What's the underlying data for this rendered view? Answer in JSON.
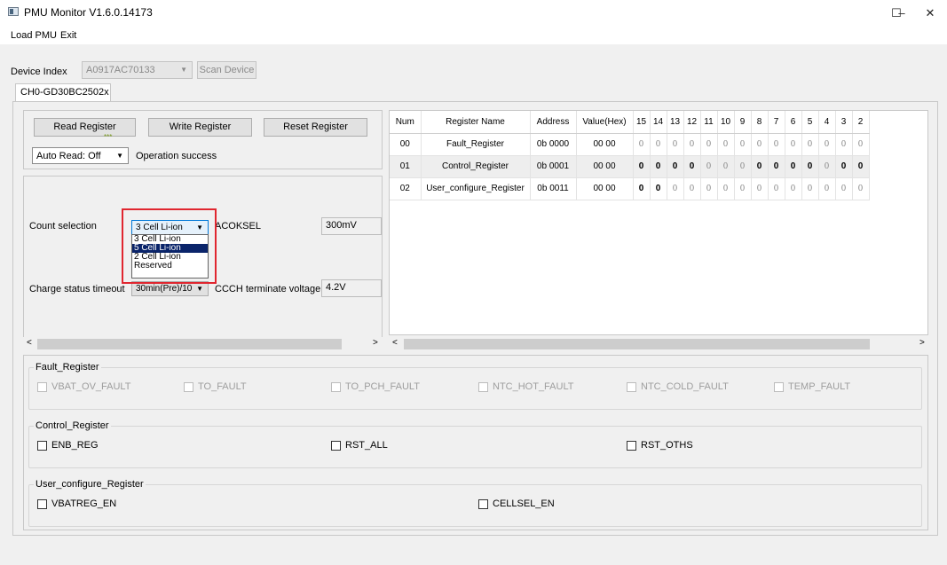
{
  "window": {
    "title": "PMU Monitor V1.6.0.14173",
    "minimize": "–",
    "maximize": "☐",
    "close": "✕"
  },
  "menu": {
    "load": "Load PMU",
    "exit": "Exit"
  },
  "device": {
    "label": "Device Index",
    "value": "A0917AC70133",
    "scan": "Scan Device",
    "tab": "CH0-GD30BC2502x"
  },
  "controls": {
    "read": "Read Register",
    "write": "Write Register",
    "reset": "Reset Register",
    "auto_read": "Auto Read: Off",
    "status": "Operation success",
    "stars": "***"
  },
  "settings": {
    "count_label": "Count selection",
    "count_value": "3 Cell Li-ion",
    "acoksel_label": "ACOKSEL",
    "acoksel_value": "300mV",
    "charge_label": "Charge status timeout",
    "charge_value": "30min(Pre)/10",
    "ccch_label": "CCCH terminate voltage",
    "ccch_value": "4.2V",
    "dropdown_options": [
      "3 Cell Li-ion",
      "5 Cell Li-ion",
      "2 Cell Li-ion",
      "Reserved"
    ],
    "dropdown_selected": "5 Cell Li-ion"
  },
  "table": {
    "headers": [
      "Num",
      "Register Name",
      "Address",
      "Value(Hex)",
      "15",
      "14",
      "13",
      "12",
      "11",
      "10",
      "9",
      "8",
      "7",
      "6",
      "5",
      "4",
      "3",
      "2"
    ],
    "rows": [
      {
        "num": "00",
        "name": "Fault_Register",
        "address": "0b 0000",
        "value": "00 00",
        "bits": [
          "0",
          "0",
          "0",
          "0",
          "0",
          "0",
          "0",
          "0",
          "0",
          "0",
          "0",
          "0",
          "0",
          "0"
        ],
        "bold": [
          false,
          false,
          false,
          false,
          false,
          false,
          false,
          false,
          false,
          false,
          false,
          false,
          false,
          false
        ]
      },
      {
        "num": "01",
        "name": "Control_Register",
        "address": "0b 0001",
        "value": "00 00",
        "bits": [
          "0",
          "0",
          "0",
          "0",
          "0",
          "0",
          "0",
          "0",
          "0",
          "0",
          "0",
          "0",
          "0",
          "0"
        ],
        "bold": [
          true,
          true,
          true,
          true,
          false,
          false,
          false,
          true,
          true,
          true,
          true,
          false,
          true,
          true
        ]
      },
      {
        "num": "02",
        "name": "User_configure_Register",
        "address": "0b 0011",
        "value": "00 00",
        "bits": [
          "0",
          "0",
          "0",
          "0",
          "0",
          "0",
          "0",
          "0",
          "0",
          "0",
          "0",
          "0",
          "0",
          "0"
        ],
        "bold": [
          true,
          true,
          false,
          false,
          false,
          false,
          false,
          false,
          false,
          false,
          false,
          false,
          false,
          false
        ]
      }
    ]
  },
  "groups": {
    "fault": {
      "title": "Fault_Register",
      "items": [
        "VBAT_OV_FAULT",
        "TO_FAULT",
        "TO_PCH_FAULT",
        "NTC_HOT_FAULT",
        "NTC_COLD_FAULT",
        "TEMP_FAULT"
      ]
    },
    "control": {
      "title": "Control_Register",
      "items": [
        "ENB_REG",
        "RST_ALL",
        "RST_OTHS"
      ]
    },
    "user": {
      "title": "User_configure_Register",
      "items": [
        "VBATREG_EN",
        "CELLSEL_EN"
      ]
    }
  }
}
